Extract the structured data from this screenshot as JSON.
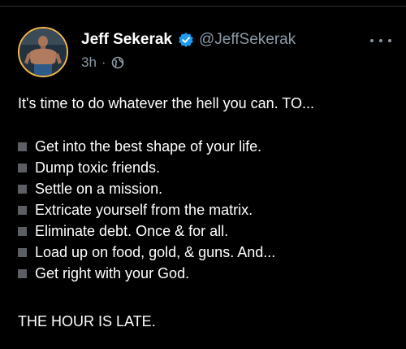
{
  "post": {
    "author": {
      "display_name": "Jeff Sekerak",
      "handle": "@JeffSekerak",
      "verified": true,
      "avatar_icon": "avatar-photo"
    },
    "meta": {
      "time": "3h",
      "separator": "·",
      "audience_icon": "globe-icon"
    },
    "more_icon": "more-horizontal-icon",
    "intro": "It's time to do whatever the hell you can. TO...",
    "bullets": [
      "Get into the best shape of your life.",
      "Dump toxic friends.",
      "Settle on a mission.",
      "Extricate yourself from the matrix.",
      "Eliminate debt. Once & for all.",
      "Load up on food, gold, & guns. And...",
      "Get right with your God."
    ],
    "closing": "THE HOUR IS LATE."
  },
  "colors": {
    "background": "#000000",
    "text": "#ffffff",
    "secondary": "#8b98a5",
    "verified_blue": "#1d9bf0",
    "bullet_square": "#5b5f63",
    "avatar_ring": "#f2b84b"
  }
}
